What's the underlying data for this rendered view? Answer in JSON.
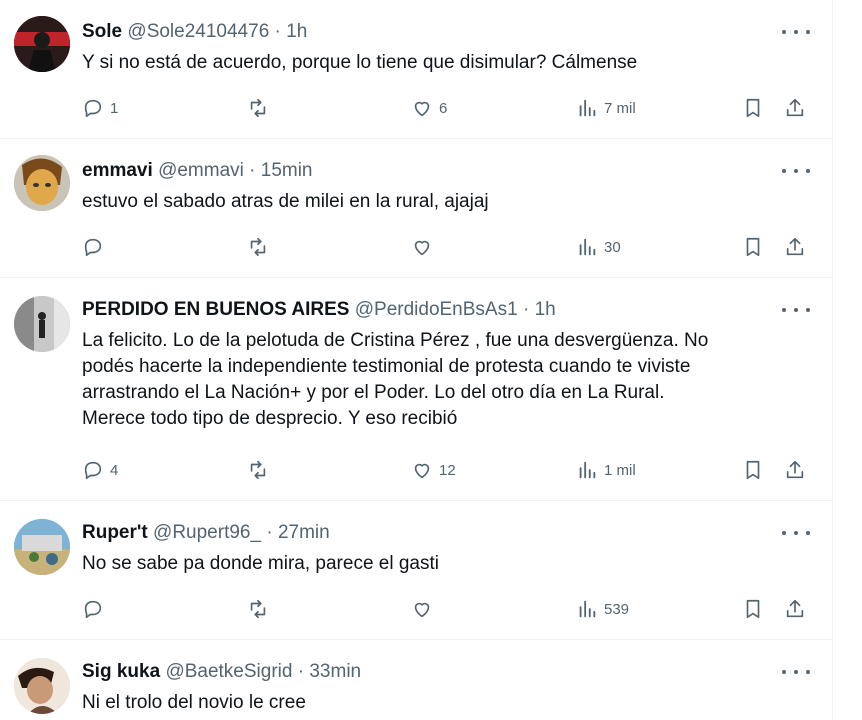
{
  "tweets": [
    {
      "name": "Sole",
      "handle": "@Sole24104476",
      "sep": "·",
      "time": "1h",
      "lines": [
        "Y si no está de acuerdo, porque lo tiene que disimular? Cálmense"
      ],
      "replies": "1",
      "reposts": "",
      "likes": "6",
      "views": "7 mil"
    },
    {
      "name": "emmavi",
      "handle": "@emmavi",
      "sep": "·",
      "time": "15min",
      "lines": [
        "estuvo el sabado atras de milei en la rural, ajajaj"
      ],
      "replies": "",
      "reposts": "",
      "likes": "",
      "views": "30"
    },
    {
      "name": "PERDIDO EN BUENOS AIRES",
      "handle": "@PerdidoEnBsAs1",
      "sep": "·",
      "time": "1h",
      "lines": [
        "La felicito.  Lo de la pelotuda de Cristina Pérez , fue una desvergüenza. No",
        "podés hacerte la independiente testimonial de protesta cuando te viviste",
        "arrastrando el La Nación+ y por el Poder.  Lo del otro día en La Rural.",
        "Merece todo tipo de desprecio.  Y eso recibió"
      ],
      "replies": "4",
      "reposts": "",
      "likes": "12",
      "views": "1 mil"
    },
    {
      "name": "Ruper't",
      "handle": "@Rupert96_",
      "sep": "·",
      "time": "27min",
      "lines": [
        "No se sabe pa donde mira, parece el gasti"
      ],
      "replies": "",
      "reposts": "",
      "likes": "",
      "views": "539"
    },
    {
      "name": "Sig kuka",
      "handle": "@BaetkeSigrid",
      "sep": "·",
      "time": "33min",
      "lines": [
        "Ni el trolo del novio le cree"
      ],
      "replies": "",
      "reposts": "",
      "likes": "",
      "views": ""
    }
  ],
  "icons": {
    "reply": "reply-icon",
    "repost": "repost-icon",
    "like": "heart-icon",
    "views": "views-icon",
    "bookmark": "bookmark-icon",
    "share": "share-icon",
    "more": "more-icon"
  },
  "colors": {
    "text": "#0f1419",
    "secondary": "#536471",
    "divider": "#eff3f4"
  }
}
